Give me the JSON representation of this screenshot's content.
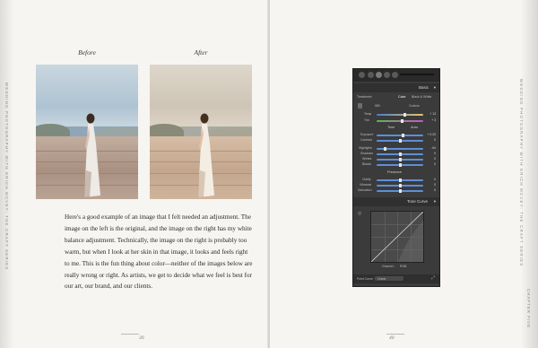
{
  "left_page": {
    "caption_before": "Before",
    "caption_after": "After",
    "spine_text": "WEDDING PHOTOGRAPHY with ERICH MCVEY: THE CRAFT SERIES",
    "body_text": "Here's a good example of an image that I felt needed an adjustment. The image on the left is the original, and the image on the right has my white balance adjustment. Technically, the image on the right is probably too warm, but when I look at her skin in that image, it looks and feels right to me. This is the fun thing about color—neither of the images below are really wrong or right. As artists, we get to decide what we feel is best for our art, our brand, and our clients.",
    "folio": "39"
  },
  "right_page": {
    "spine_text": "WEDDING PHOTOGRAPHY with ERICH MCVEY: THE CRAFT SERIES",
    "chapter_text": "CHAPTER FIVE",
    "folio": "40"
  },
  "lightroom": {
    "basic_title": "Basic",
    "treatment_label": "Treatment:",
    "treatment_color": "Color",
    "treatment_bw": "Black & White",
    "wb_label": "WB :",
    "wb_value": "Custom",
    "temp_label": "Temp",
    "temp_value": "+ 13",
    "tint_label": "Tint",
    "tint_value": "+ 3",
    "tone_label": "Tone",
    "tone_auto": "Auto",
    "exposure_label": "Exposure",
    "exposure_value": "+ 0.20",
    "contrast_label": "Contrast",
    "contrast_value": "0",
    "highlights_label": "Highlights",
    "highlights_value": "- 64",
    "shadows_label": "Shadows",
    "shadows_value": "0",
    "whites_label": "Whites",
    "whites_value": "0",
    "blacks_label": "Blacks",
    "blacks_value": "0",
    "presence_label": "Presence",
    "clarity_label": "Clarity",
    "clarity_value": "0",
    "vibrance_label": "Vibrance",
    "vibrance_value": "0",
    "saturation_label": "Saturation",
    "saturation_value": "0",
    "tone_curve_title": "Tone Curve",
    "channel_label": "Channel :",
    "channel_value": "RGB",
    "point_curve_label": "Point Curve :",
    "point_curve_value": "Linear"
  },
  "colors": {
    "page": "#f6f5f2",
    "panel": "#3b3b3b",
    "slider_blue": "#5d8fd8",
    "sky_before": "#b9cedd",
    "sky_after": "#d6cfc4",
    "sand_before": "#b59d8b",
    "sand_after": "#c9ab92"
  }
}
